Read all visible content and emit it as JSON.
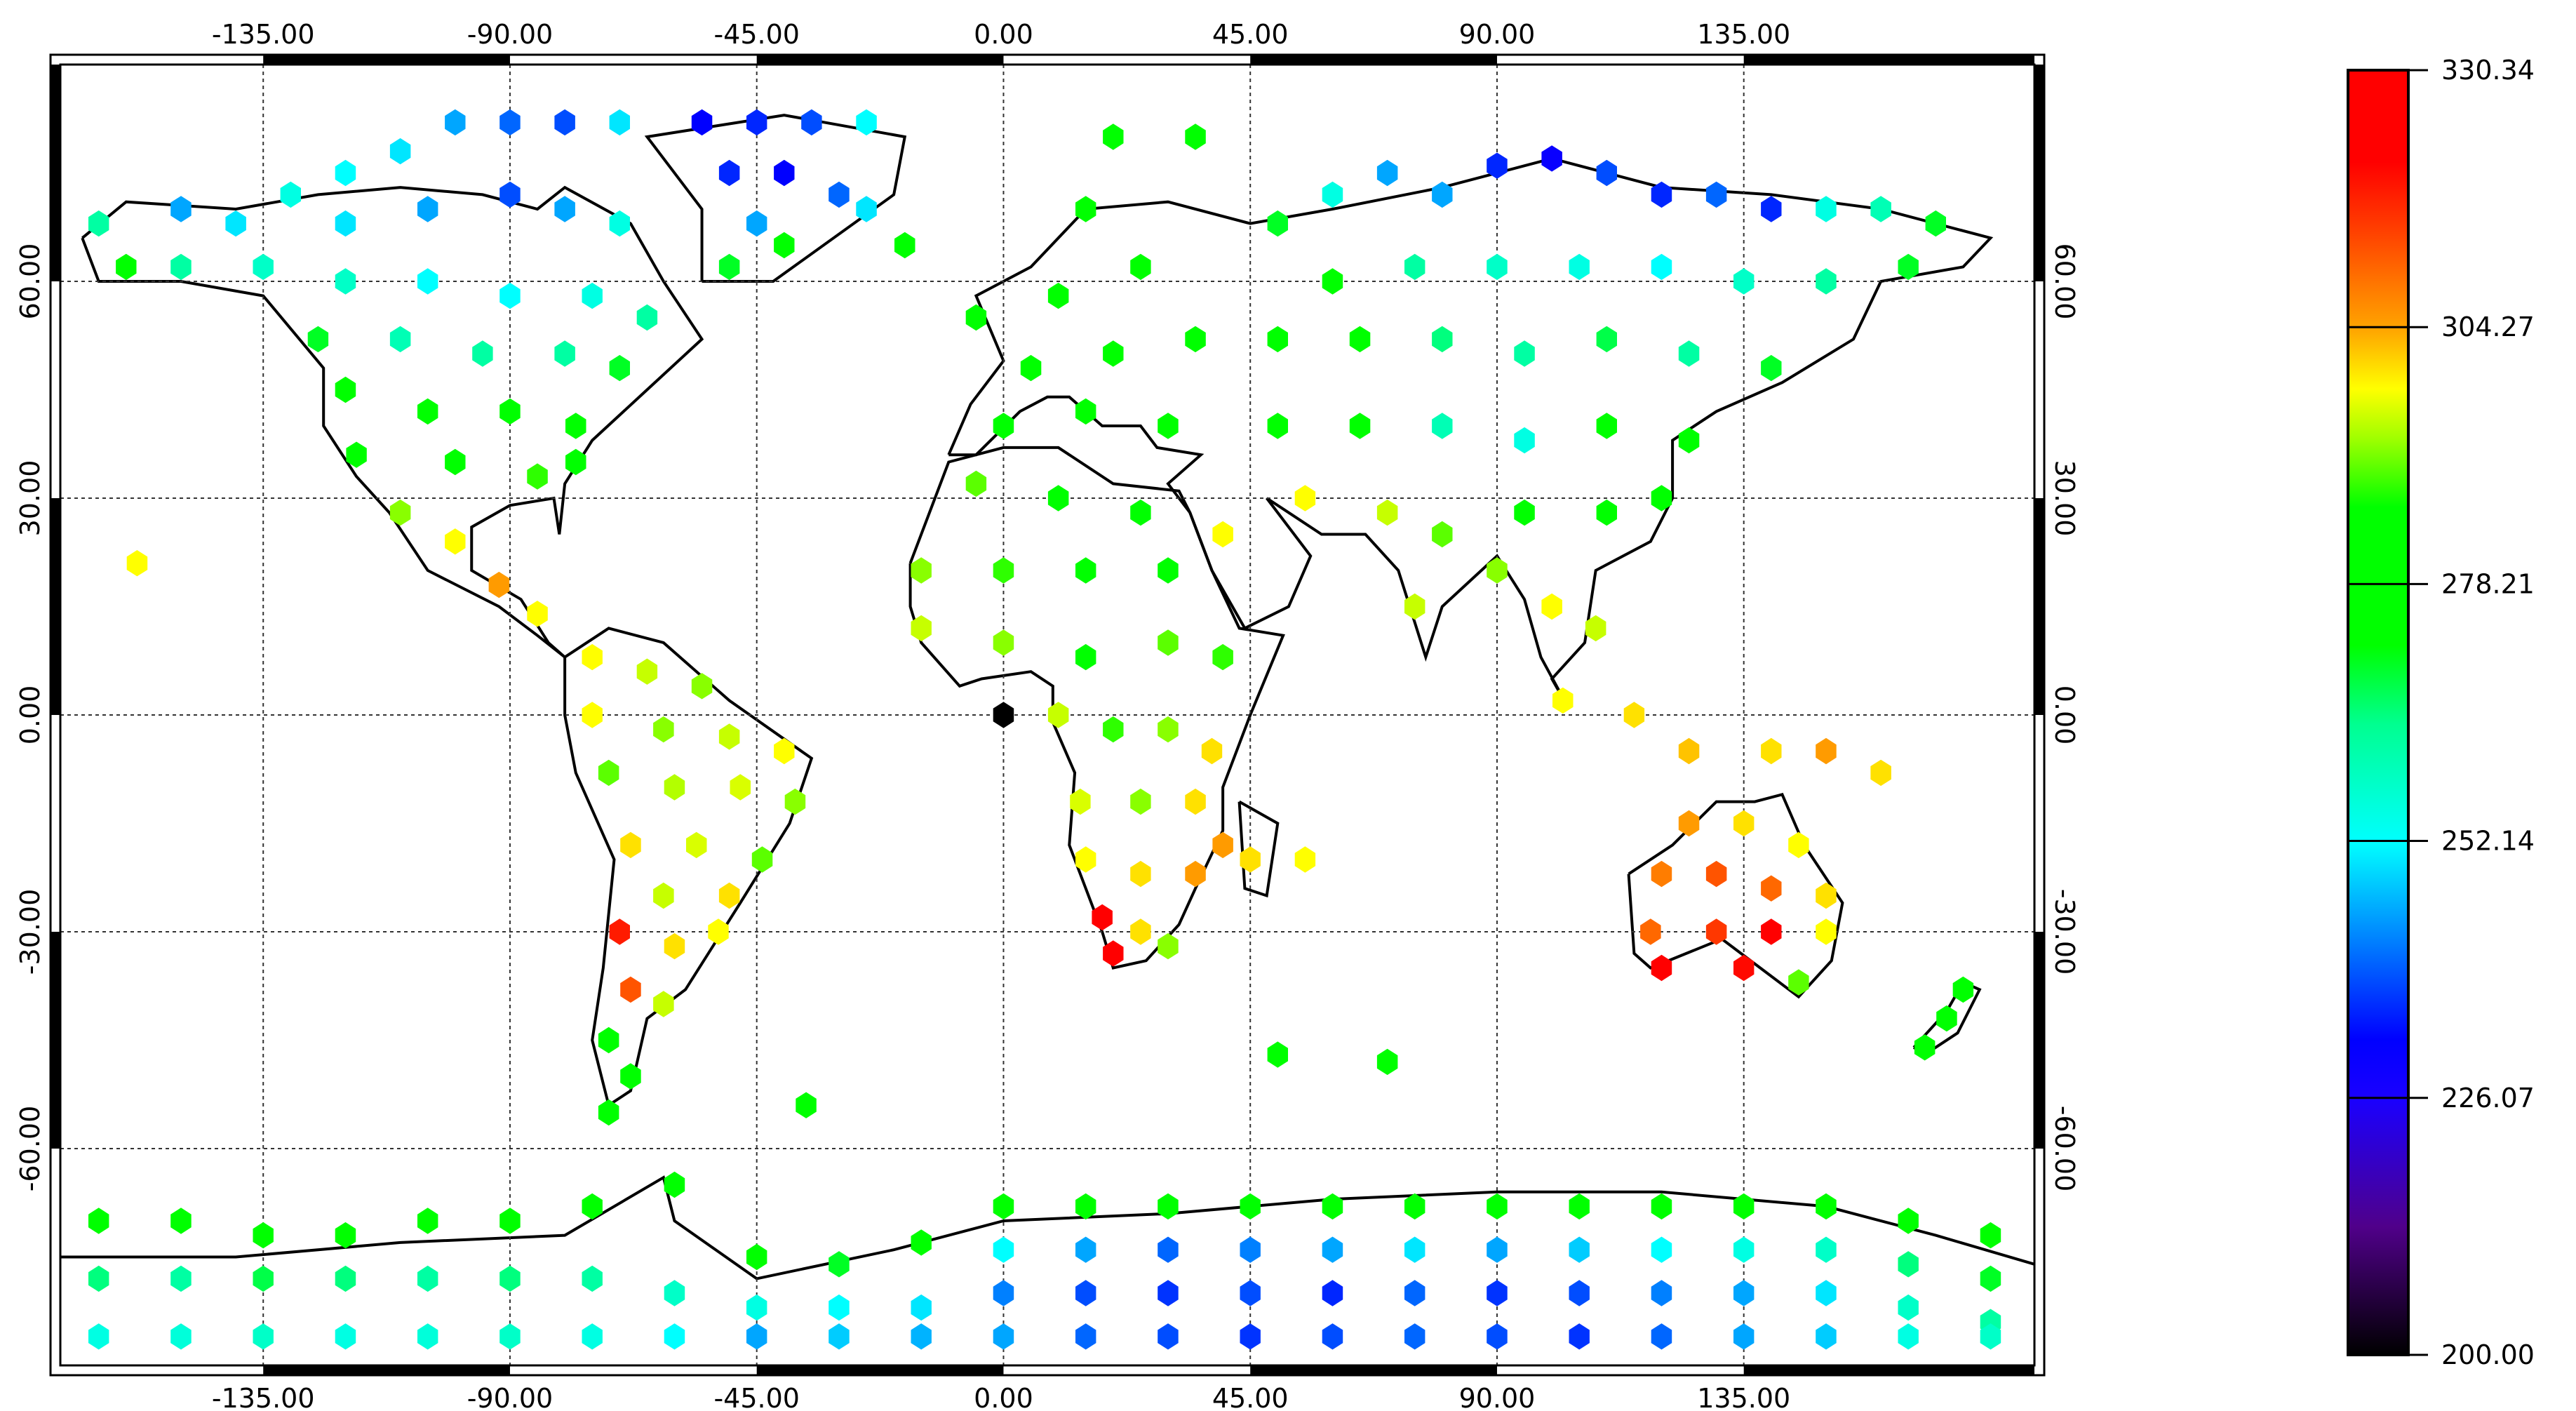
{
  "map": {
    "lon_range": [
      -172,
      188
    ],
    "lat_range": [
      -90,
      90
    ],
    "lon_ticks": [
      -135,
      -90,
      -45,
      0,
      45,
      90,
      135
    ],
    "lon_tick_labels": [
      "-135.00",
      "-90.00",
      "-45.00",
      "0.00",
      "45.00",
      "90.00",
      "135.00"
    ],
    "lat_ticks": [
      60,
      30,
      0,
      -30,
      -60
    ],
    "lat_tick_labels": [
      "60.00",
      "30.00",
      "0.00",
      "-30.00",
      "-60.00"
    ],
    "grid": true
  },
  "colorbar": {
    "min": 200.0,
    "max": 330.34,
    "tick_values": [
      330.34,
      304.27,
      278.21,
      252.14,
      226.07,
      200.0
    ],
    "tick_labels": [
      "330.34",
      "304.27",
      "278.21",
      "252.14",
      "226.07",
      "200.00"
    ],
    "stops": [
      {
        "v": 200,
        "c": "#000000"
      },
      {
        "v": 213,
        "c": "#50008a"
      },
      {
        "v": 226,
        "c": "#1a00ff"
      },
      {
        "v": 232,
        "c": "#0000ff"
      },
      {
        "v": 242,
        "c": "#0080ff"
      },
      {
        "v": 252,
        "c": "#00ffff"
      },
      {
        "v": 264,
        "c": "#00ff90"
      },
      {
        "v": 272,
        "c": "#00ff00"
      },
      {
        "v": 286,
        "c": "#00ff00"
      },
      {
        "v": 293,
        "c": "#a0ff00"
      },
      {
        "v": 298,
        "c": "#ffff00"
      },
      {
        "v": 304,
        "c": "#ffa500"
      },
      {
        "v": 314,
        "c": "#ff4000"
      },
      {
        "v": 321,
        "c": "#ff0000"
      },
      {
        "v": 331,
        "c": "#ff0000"
      }
    ]
  },
  "points": [
    [
      -165,
      68,
      262
    ],
    [
      -160,
      62,
      275
    ],
    [
      -150,
      70,
      245
    ],
    [
      -140,
      68,
      250
    ],
    [
      -130,
      72,
      255
    ],
    [
      -120,
      75,
      252
    ],
    [
      -110,
      78,
      250
    ],
    [
      -100,
      82,
      245
    ],
    [
      -90,
      82,
      240
    ],
    [
      -80,
      82,
      238
    ],
    [
      -70,
      82,
      250
    ],
    [
      -120,
      68,
      250
    ],
    [
      -105,
      70,
      245
    ],
    [
      -90,
      72,
      238
    ],
    [
      -80,
      70,
      245
    ],
    [
      -70,
      68,
      255
    ],
    [
      -150,
      62,
      262
    ],
    [
      -135,
      62,
      258
    ],
    [
      -120,
      60,
      258
    ],
    [
      -105,
      60,
      252
    ],
    [
      -90,
      58,
      252
    ],
    [
      -75,
      58,
      255
    ],
    [
      -65,
      55,
      262
    ],
    [
      -125,
      52,
      270
    ],
    [
      -110,
      52,
      260
    ],
    [
      -95,
      50,
      262
    ],
    [
      -80,
      50,
      262
    ],
    [
      -70,
      48,
      270
    ],
    [
      -120,
      45,
      275
    ],
    [
      -105,
      42,
      272
    ],
    [
      -90,
      42,
      275
    ],
    [
      -78,
      40,
      278
    ],
    [
      -118,
      36,
      285
    ],
    [
      -100,
      35,
      285
    ],
    [
      -85,
      33,
      288
    ],
    [
      -110,
      28,
      292
    ],
    [
      -100,
      24,
      298
    ],
    [
      -92,
      18,
      305
    ],
    [
      -85,
      14,
      298
    ],
    [
      -158,
      21,
      298
    ],
    [
      -78,
      35,
      282
    ],
    [
      -55,
      82,
      232
    ],
    [
      -45,
      82,
      235
    ],
    [
      -35,
      82,
      238
    ],
    [
      -25,
      82,
      252
    ],
    [
      -50,
      75,
      235
    ],
    [
      -40,
      75,
      232
    ],
    [
      -30,
      72,
      240
    ],
    [
      -45,
      68,
      245
    ],
    [
      -25,
      70,
      250
    ],
    [
      -50,
      62,
      270
    ],
    [
      -40,
      65,
      275
    ],
    [
      -75,
      8,
      298
    ],
    [
      -65,
      6,
      295
    ],
    [
      -55,
      4,
      292
    ],
    [
      -75,
      0,
      298
    ],
    [
      -62,
      -2,
      292
    ],
    [
      -50,
      -3,
      295
    ],
    [
      -40,
      -5,
      298
    ],
    [
      -72,
      -8,
      290
    ],
    [
      -60,
      -10,
      294
    ],
    [
      -48,
      -10,
      296
    ],
    [
      -38,
      -12,
      292
    ],
    [
      -68,
      -18,
      300
    ],
    [
      -56,
      -18,
      296
    ],
    [
      -44,
      -20,
      290
    ],
    [
      -62,
      -25,
      295
    ],
    [
      -50,
      -25,
      300
    ],
    [
      -70,
      -30,
      318
    ],
    [
      -60,
      -32,
      300
    ],
    [
      -52,
      -30,
      298
    ],
    [
      -68,
      -38,
      312
    ],
    [
      -62,
      -40,
      295
    ],
    [
      -72,
      -45,
      282
    ],
    [
      -68,
      -50,
      280
    ],
    [
      -72,
      -55,
      278
    ],
    [
      -36,
      -54,
      278
    ],
    [
      -5,
      55,
      276
    ],
    [
      10,
      58,
      275
    ],
    [
      25,
      62,
      275
    ],
    [
      15,
      70,
      275
    ],
    [
      -18,
      65,
      278
    ],
    [
      20,
      80,
      275
    ],
    [
      35,
      80,
      280
    ],
    [
      5,
      48,
      276
    ],
    [
      20,
      50,
      275
    ],
    [
      35,
      52,
      274
    ],
    [
      0,
      40,
      282
    ],
    [
      15,
      42,
      280
    ],
    [
      30,
      40,
      278
    ],
    [
      -5,
      32,
      290
    ],
    [
      10,
      30,
      285
    ],
    [
      25,
      28,
      282
    ],
    [
      -15,
      20,
      292
    ],
    [
      0,
      20,
      288
    ],
    [
      15,
      20,
      280
    ],
    [
      30,
      20,
      285
    ],
    [
      40,
      25,
      298
    ],
    [
      -15,
      12,
      295
    ],
    [
      0,
      10,
      292
    ],
    [
      15,
      8,
      285
    ],
    [
      30,
      10,
      290
    ],
    [
      40,
      8,
      288
    ],
    [
      10,
      0,
      295
    ],
    [
      20,
      -2,
      288
    ],
    [
      30,
      -2,
      292
    ],
    [
      38,
      -5,
      300
    ],
    [
      14,
      -12,
      296
    ],
    [
      25,
      -12,
      292
    ],
    [
      35,
      -12,
      300
    ],
    [
      40,
      -18,
      305
    ],
    [
      15,
      -20,
      298
    ],
    [
      25,
      -22,
      300
    ],
    [
      35,
      -22,
      305
    ],
    [
      18,
      -28,
      322
    ],
    [
      25,
      -30,
      300
    ],
    [
      20,
      -33,
      325
    ],
    [
      30,
      -32,
      292
    ],
    [
      45,
      -20,
      300
    ],
    [
      55,
      -20,
      298
    ],
    [
      0,
      0,
      200
    ],
    [
      50,
      68,
      270
    ],
    [
      60,
      72,
      255
    ],
    [
      70,
      75,
      245
    ],
    [
      80,
      72,
      245
    ],
    [
      90,
      76,
      235
    ],
    [
      100,
      77,
      230
    ],
    [
      110,
      75,
      238
    ],
    [
      120,
      72,
      235
    ],
    [
      130,
      72,
      240
    ],
    [
      140,
      70,
      235
    ],
    [
      150,
      70,
      255
    ],
    [
      160,
      70,
      260
    ],
    [
      170,
      68,
      270
    ],
    [
      60,
      60,
      275
    ],
    [
      75,
      62,
      262
    ],
    [
      90,
      62,
      258
    ],
    [
      105,
      62,
      255
    ],
    [
      120,
      62,
      252
    ],
    [
      135,
      60,
      258
    ],
    [
      150,
      60,
      262
    ],
    [
      165,
      62,
      270
    ],
    [
      50,
      52,
      278
    ],
    [
      65,
      52,
      275
    ],
    [
      80,
      52,
      265
    ],
    [
      95,
      50,
      262
    ],
    [
      110,
      52,
      268
    ],
    [
      125,
      50,
      262
    ],
    [
      140,
      48,
      270
    ],
    [
      50,
      40,
      282
    ],
    [
      65,
      40,
      278
    ],
    [
      80,
      40,
      260
    ],
    [
      95,
      38,
      255
    ],
    [
      110,
      40,
      275
    ],
    [
      125,
      38,
      278
    ],
    [
      55,
      30,
      298
    ],
    [
      70,
      28,
      295
    ],
    [
      80,
      25,
      290
    ],
    [
      95,
      28,
      280
    ],
    [
      110,
      28,
      278
    ],
    [
      120,
      30,
      282
    ],
    [
      75,
      15,
      295
    ],
    [
      90,
      20,
      292
    ],
    [
      100,
      15,
      298
    ],
    [
      108,
      12,
      295
    ],
    [
      102,
      2,
      298
    ],
    [
      115,
      0,
      300
    ],
    [
      125,
      -5,
      302
    ],
    [
      140,
      -5,
      300
    ],
    [
      150,
      -5,
      305
    ],
    [
      160,
      -8,
      300
    ],
    [
      125,
      -15,
      305
    ],
    [
      135,
      -15,
      300
    ],
    [
      145,
      -18,
      298
    ],
    [
      120,
      -22,
      308
    ],
    [
      130,
      -22,
      312
    ],
    [
      140,
      -24,
      310
    ],
    [
      150,
      -25,
      300
    ],
    [
      118,
      -30,
      310
    ],
    [
      130,
      -30,
      315
    ],
    [
      140,
      -30,
      322
    ],
    [
      150,
      -30,
      298
    ],
    [
      120,
      -35,
      325
    ],
    [
      135,
      -35,
      320
    ],
    [
      145,
      -37,
      290
    ],
    [
      172,
      -42,
      280
    ],
    [
      175,
      -38,
      282
    ],
    [
      168,
      -46,
      276
    ],
    [
      50,
      -47,
      278
    ],
    [
      70,
      -48,
      278
    ],
    [
      -165,
      -70,
      276
    ],
    [
      -150,
      -70,
      275
    ],
    [
      -135,
      -72,
      272
    ],
    [
      -120,
      -72,
      275
    ],
    [
      -105,
      -70,
      272
    ],
    [
      -90,
      -70,
      276
    ],
    [
      -75,
      -68,
      275
    ],
    [
      -60,
      -65,
      276
    ],
    [
      -45,
      -75,
      272
    ],
    [
      -30,
      -76,
      270
    ],
    [
      -15,
      -73,
      272
    ],
    [
      -165,
      -78,
      265
    ],
    [
      -150,
      -78,
      262
    ],
    [
      -135,
      -78,
      268
    ],
    [
      -120,
      -78,
      265
    ],
    [
      -105,
      -78,
      262
    ],
    [
      -90,
      -78,
      265
    ],
    [
      -75,
      -78,
      262
    ],
    [
      -60,
      -80,
      258
    ],
    [
      -45,
      -82,
      255
    ],
    [
      -30,
      -82,
      252
    ],
    [
      -15,
      -82,
      250
    ],
    [
      -165,
      -86,
      255
    ],
    [
      -150,
      -86,
      256
    ],
    [
      -135,
      -86,
      258
    ],
    [
      -120,
      -86,
      255
    ],
    [
      -105,
      -86,
      256
    ],
    [
      -90,
      -86,
      258
    ],
    [
      -75,
      -86,
      255
    ],
    [
      -60,
      -86,
      252
    ],
    [
      -45,
      -86,
      245
    ],
    [
      -30,
      -86,
      248
    ],
    [
      -15,
      -86,
      246
    ],
    [
      0,
      -68,
      276
    ],
    [
      15,
      -68,
      275
    ],
    [
      30,
      -68,
      276
    ],
    [
      45,
      -68,
      275
    ],
    [
      60,
      -68,
      276
    ],
    [
      75,
      -68,
      275
    ],
    [
      90,
      -68,
      276
    ],
    [
      105,
      -68,
      275
    ],
    [
      120,
      -68,
      276
    ],
    [
      135,
      -68,
      275
    ],
    [
      150,
      -68,
      272
    ],
    [
      165,
      -70,
      275
    ],
    [
      180,
      -72,
      276
    ],
    [
      0,
      -74,
      252
    ],
    [
      15,
      -74,
      245
    ],
    [
      30,
      -74,
      240
    ],
    [
      45,
      -74,
      242
    ],
    [
      60,
      -74,
      245
    ],
    [
      75,
      -74,
      250
    ],
    [
      90,
      -74,
      245
    ],
    [
      105,
      -74,
      248
    ],
    [
      120,
      -74,
      252
    ],
    [
      135,
      -74,
      255
    ],
    [
      150,
      -74,
      258
    ],
    [
      165,
      -76,
      265
    ],
    [
      180,
      -78,
      270
    ],
    [
      0,
      -80,
      242
    ],
    [
      15,
      -80,
      238
    ],
    [
      30,
      -80,
      236
    ],
    [
      45,
      -80,
      238
    ],
    [
      60,
      -80,
      235
    ],
    [
      75,
      -80,
      240
    ],
    [
      90,
      -80,
      236
    ],
    [
      105,
      -80,
      238
    ],
    [
      120,
      -80,
      242
    ],
    [
      135,
      -80,
      245
    ],
    [
      150,
      -80,
      250
    ],
    [
      165,
      -82,
      258
    ],
    [
      180,
      -84,
      262
    ],
    [
      0,
      -86,
      245
    ],
    [
      15,
      -86,
      240
    ],
    [
      30,
      -86,
      238
    ],
    [
      45,
      -86,
      236
    ],
    [
      60,
      -86,
      238
    ],
    [
      75,
      -86,
      240
    ],
    [
      90,
      -86,
      238
    ],
    [
      105,
      -86,
      236
    ],
    [
      120,
      -86,
      240
    ],
    [
      135,
      -86,
      245
    ],
    [
      150,
      -86,
      248
    ],
    [
      165,
      -86,
      255
    ],
    [
      180,
      -86,
      258
    ]
  ]
}
